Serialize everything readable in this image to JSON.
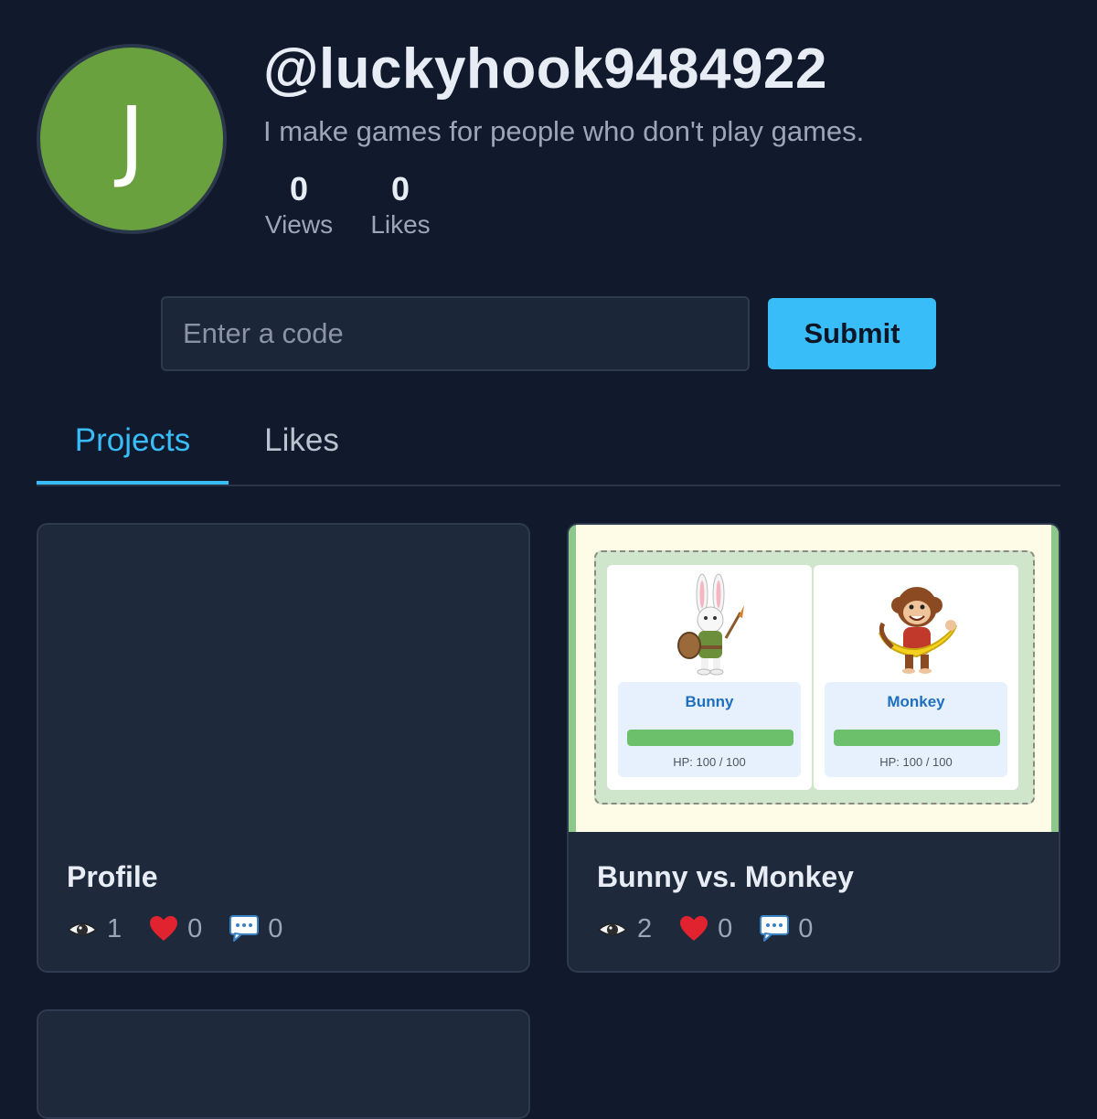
{
  "profile": {
    "avatar_initial": "J",
    "avatar_color": "#69a13f",
    "username": "@luckyhook9484922",
    "bio": "I make games for people who don't play games.",
    "stats": {
      "views_count": "0",
      "views_label": "Views",
      "likes_count": "0",
      "likes_label": "Likes"
    }
  },
  "code_form": {
    "placeholder": "Enter a code",
    "value": "",
    "submit_label": "Submit"
  },
  "tabs": [
    {
      "label": "Projects",
      "active": true
    },
    {
      "label": "Likes",
      "active": false
    }
  ],
  "colors": {
    "background": "#111a2c",
    "card": "#1e293b",
    "accent": "#38bdf8",
    "heart": "#e0232f"
  },
  "projects": [
    {
      "title": "Profile",
      "views": "1",
      "likes": "0",
      "comments": "0",
      "thumbnail": "none"
    },
    {
      "title": "Bunny vs. Monkey",
      "views": "2",
      "likes": "0",
      "comments": "0",
      "thumbnail": {
        "fighters": [
          {
            "name": "Bunny",
            "hp": "HP: 100 / 100",
            "hp_fraction": 1.0,
            "icon": "bunny-warrior-icon"
          },
          {
            "name": "Monkey",
            "hp": "HP: 100 / 100",
            "hp_fraction": 1.0,
            "icon": "monkey-banana-icon"
          }
        ]
      }
    },
    {
      "title": "",
      "thumbnail": "none"
    }
  ],
  "icons": {
    "views": "eye-icon",
    "likes": "heart-icon",
    "comments": "speech-bubble-icon"
  }
}
